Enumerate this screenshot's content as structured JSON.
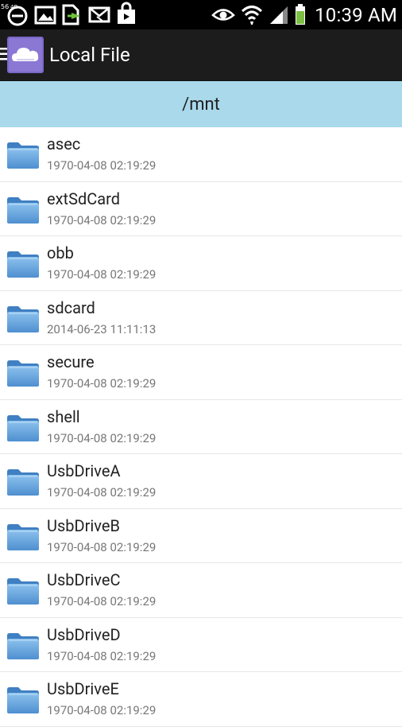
{
  "status_bar": {
    "time": "10:39 AM",
    "notification_icons": [
      "minus-circle-icon",
      "image-icon",
      "file-export-icon",
      "envelope-icon",
      "shopping-bag-icon"
    ],
    "system_icons": [
      "eye-icon",
      "wifi-icon",
      "signal-icon",
      "battery-icon"
    ],
    "colors": {
      "background": "#000000",
      "battery_fill": "#7bc042"
    }
  },
  "action_bar": {
    "title": "Local File",
    "menu_icon": "hamburger-icon",
    "app_icon": "cloud-app-icon",
    "colors": {
      "background": "#1c1c1c",
      "app_icon_bg": "#7b68c6"
    }
  },
  "path_bar": {
    "path": "/mnt",
    "colors": {
      "background": "#a9d9eb"
    }
  },
  "files": [
    {
      "name": "asec",
      "date": "1970-04-08 02:19:29",
      "icon": "folder-icon"
    },
    {
      "name": "extSdCard",
      "date": "1970-04-08 02:19:29",
      "icon": "folder-icon"
    },
    {
      "name": "obb",
      "date": "1970-04-08 02:19:29",
      "icon": "folder-icon"
    },
    {
      "name": "sdcard",
      "date": "2014-06-23 11:11:13",
      "icon": "folder-icon"
    },
    {
      "name": "secure",
      "date": "1970-04-08 02:19:29",
      "icon": "folder-icon"
    },
    {
      "name": "shell",
      "date": "1970-04-08 02:19:29",
      "icon": "folder-icon"
    },
    {
      "name": "UsbDriveA",
      "date": "1970-04-08 02:19:29",
      "icon": "folder-icon"
    },
    {
      "name": "UsbDriveB",
      "date": "1970-04-08 02:19:29",
      "icon": "folder-icon"
    },
    {
      "name": "UsbDriveC",
      "date": "1970-04-08 02:19:29",
      "icon": "folder-icon"
    },
    {
      "name": "UsbDriveD",
      "date": "1970-04-08 02:19:29",
      "icon": "folder-icon"
    },
    {
      "name": "UsbDriveE",
      "date": "1970-04-08 02:19:29",
      "icon": "folder-icon"
    }
  ],
  "colors": {
    "folder": "#5b9bd5",
    "folder_light": "#8cc2ee",
    "divider": "#e6e6e6"
  }
}
